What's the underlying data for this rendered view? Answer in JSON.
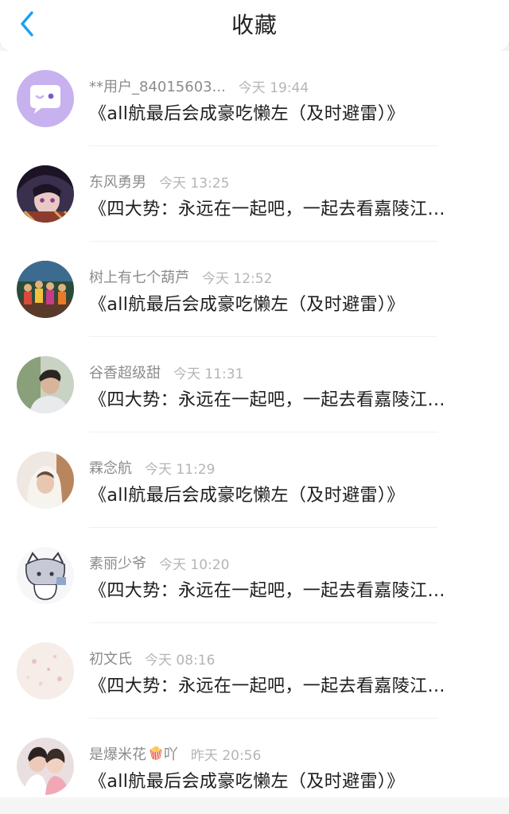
{
  "header": {
    "title": "收藏",
    "back_icon": "chevron-left-icon",
    "accent_color": "#1aa1f2"
  },
  "items": [
    {
      "name": "**用户_84015603...",
      "time": "今天 19:44",
      "title": "《all航最后会成豪吃懒左（及时避雷）》",
      "avatar": "default-chat-avatar"
    },
    {
      "name": "东风勇男",
      "time": "今天 13:25",
      "title": "《四大势：永远在一起吧，一起去看嘉陵江...",
      "avatar": "anime-character-avatar"
    },
    {
      "name": "树上有七个葫芦",
      "time": "今天 12:52",
      "title": "《all航最后会成豪吃懒左（及时避雷）》",
      "avatar": "stage-performers-avatar"
    },
    {
      "name": "谷香超级甜",
      "time": "今天 11:31",
      "title": "《四大势：永远在一起吧，一起去看嘉陵江...",
      "avatar": "boy-photo-avatar"
    },
    {
      "name": "霖念航",
      "time": "今天 11:29",
      "title": "《all航最后会成豪吃懒左（及时避雷）》",
      "avatar": "hooded-person-avatar"
    },
    {
      "name": "素丽少爷",
      "time": "今天 10:20",
      "title": "《四大势：永远在一起吧，一起去看嘉陵江...",
      "avatar": "sketch-character-avatar"
    },
    {
      "name": "初文氏",
      "time": "今天 08:16",
      "title": "《四大势：永远在一起吧，一起去看嘉陵江...",
      "avatar": "floral-pattern-avatar"
    },
    {
      "name": "是爆米花",
      "name_emoji": "🍿",
      "name_suffix": "吖",
      "time": "昨天 20:56",
      "title": "《all航最后会成豪吃懒左（及时避雷）》",
      "avatar": "pair-photo-avatar"
    }
  ]
}
